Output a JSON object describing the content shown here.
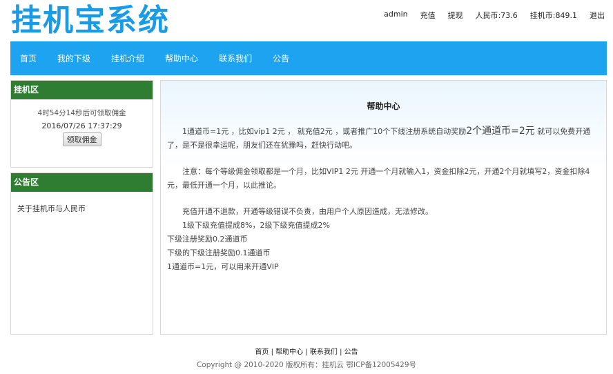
{
  "header": {
    "logo": "挂机宝系统",
    "links": [
      "admin",
      "充值",
      "提现",
      "人民币:73.6",
      "挂机币:849.1",
      "退出"
    ]
  },
  "nav": [
    "首页",
    "我的下级",
    "挂机介绍",
    "帮助中心",
    "联系我们",
    "公告"
  ],
  "sidebar": {
    "hang": {
      "title": "挂机区",
      "countdown": "4时54分14秒后可领取佣金",
      "datetime": "2016/07/26 17:37:29",
      "button": "领取佣金"
    },
    "notice": {
      "title": "公告区",
      "items": [
        "关于挂机币与人民币"
      ]
    }
  },
  "content": {
    "title": "帮助中心",
    "p1a": "1通道币=1元 ，比如vip1 2元 ， 就充值2元 ，或者推广10个下线注册系统自动奖励",
    "p1big": "2个通道币=2元",
    "p1b": "就可以免费开通了，是不是很幸运呢，朋友们还在犹豫吗，赶快行动吧。",
    "p2": "注意：每个等级佣金领取都是一个月，比如VIP1 2元 开通一个月就输入1，资金扣除2元，开通2个月就填写2，资金扣除4元，最低开通一个月，以此推论。",
    "p3": "充值开通不退款，开通等级错误不负责，由用户个人原因造成，无法修改。",
    "p4": "1级下级充值提成8%，2级下级充值提成2%",
    "p5": "下级注册奖励0.2通道币",
    "p6": "下级的下级注册奖励0.1通道币",
    "p7": "1通道币=1元，可以用来开通VIP"
  },
  "footer": {
    "links": [
      "首页",
      "帮助中心",
      "联系我们",
      "公告"
    ],
    "separator": "|",
    "copyright": "Copyright @ 2010-2020 版权所有：挂机云 鄂ICP备12005429号"
  },
  "colors": {
    "nav_bg": "#1ea3f0",
    "logo": "#1a9be6",
    "panel_head": "#2f7d32"
  }
}
